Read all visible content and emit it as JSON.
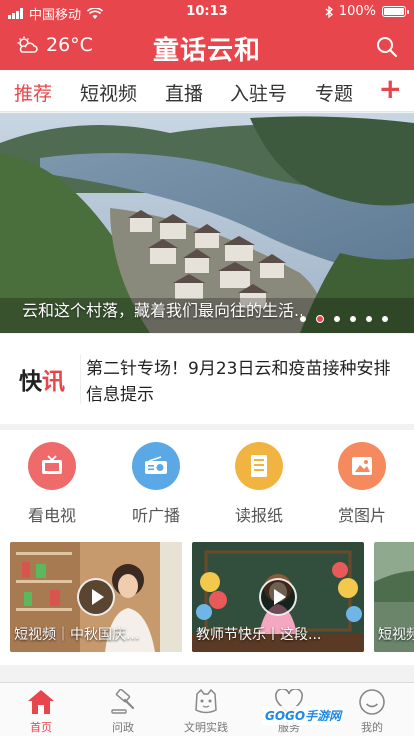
{
  "status_bar": {
    "carrier": "中国移动",
    "time": "10:13",
    "battery": "100%",
    "battery_level": 1.0
  },
  "header": {
    "temperature": "26°C",
    "weather_icon": "partly-cloudy-icon",
    "logo": "童话云和",
    "search_icon": "search-icon",
    "background": "#e7474c"
  },
  "tabs": {
    "items": [
      "推荐",
      "短视频",
      "直播",
      "入驻号",
      "专题"
    ],
    "active": "推荐",
    "add_label": "+"
  },
  "banner": {
    "caption": "云和这个村落，藏着我们最向往的生活...",
    "slide_count": 6,
    "active_index": 1
  },
  "kuaixun": {
    "tag": [
      "快",
      "讯"
    ],
    "headline": "第二针专场！9月23日云和疫苗接种安排信息提示"
  },
  "quick_links": [
    {
      "label": "看电视",
      "icon": "tv-icon",
      "color": "#ef6a6a"
    },
    {
      "label": "听广播",
      "icon": "radio-icon",
      "color": "#5aa9e6"
    },
    {
      "label": "读报纸",
      "icon": "newspaper-icon",
      "color": "#f2b441"
    },
    {
      "label": "赏图片",
      "icon": "picture-icon",
      "color": "#f58a5e"
    }
  ],
  "videos": [
    {
      "caption": "短视频｜中秋国庆..."
    },
    {
      "caption": "教师节快乐丨这段..."
    },
    {
      "caption": "短视频..."
    }
  ],
  "bottom_nav": [
    {
      "label": "首页",
      "icon": "home-icon",
      "active": true
    },
    {
      "label": "问政",
      "icon": "gavel-icon",
      "active": false
    },
    {
      "label": "文明实践",
      "icon": "mascot-icon",
      "active": false
    },
    {
      "label": "服务",
      "icon": "heart-icon",
      "active": false
    },
    {
      "label": "我的",
      "icon": "smile-icon",
      "active": false
    }
  ],
  "watermark": {
    "brand": "GOGO手游网",
    "url": "GOGO.COM"
  },
  "accent_color": "#e7474c"
}
